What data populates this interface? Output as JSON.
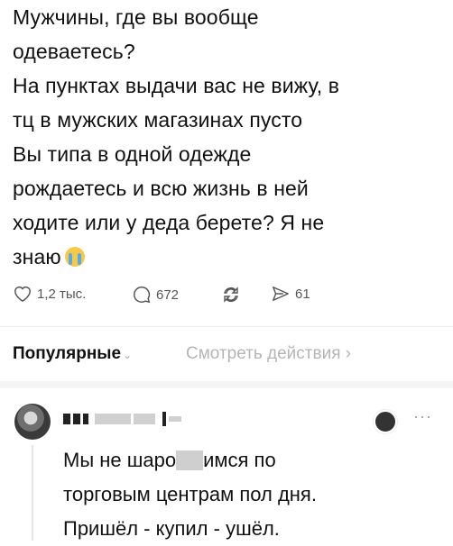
{
  "post": {
    "lines": [
      "Мужчины, где вы вообще",
      "одеваетесь?",
      "На пунктах выдачи вас не вижу, в",
      "тц в мужских магазинах пусто",
      "Вы типа в одной одежде",
      "рождаетесь и всю жизнь в ней",
      "ходите или у деда берете? Я не",
      "знаю"
    ],
    "emoji": "crying-face-icon"
  },
  "actions": {
    "likes": "1,2 тыс.",
    "replies": "672",
    "reposts": "",
    "shares": "61"
  },
  "tabs": {
    "popular": "Популярные",
    "view_actions": "Смотреть действия",
    "view_actions_chevron": "›"
  },
  "comment": {
    "line1_a": "Мы не шаро",
    "line1_b": "имся по",
    "line2": "торговым центрам пол дня.",
    "line3": "Пришёл - купил - ушёл.",
    "more": "···"
  },
  "colors": {
    "text": "#111111",
    "muted": "#555555",
    "inactive_tab": "#b5b5b5"
  }
}
